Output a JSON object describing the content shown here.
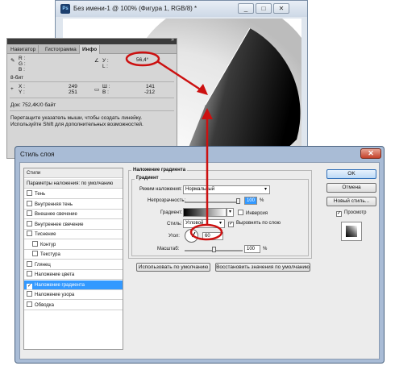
{
  "document": {
    "ps_label": "Ps",
    "title": "Без имени-1 @ 100% (Фигура 1, RGB/8) *",
    "minimize": "_",
    "maximize": "□",
    "close": "✕"
  },
  "info_panel": {
    "collapse": "»",
    "tabs": [
      "Навигатор",
      "Гистограмма",
      "Инфо"
    ],
    "r_label": "R :",
    "g_label": "G :",
    "b_label": "B :",
    "bit_depth": "8-бит",
    "y_label": "У :",
    "l_label": "L :",
    "angle_value": "56,4°",
    "x_label": "X :",
    "y2_label": "Y :",
    "x_value": "249",
    "y_value": "251",
    "w_label": "Ш :",
    "h_label": "В :",
    "w_value": "141",
    "h_value": "-212",
    "doc_size": "Док: 752,4K/0 байт",
    "hint_line1": "Перетащите указатель мыши, чтобы создать линейку.",
    "hint_line2": "Используйте Shift для дополнительных возможностей."
  },
  "dialog": {
    "title": "Стиль слоя",
    "close": "✕",
    "styles_header": "Стили",
    "blend_defaults": "Параметры наложения: по умолчанию",
    "style_items": [
      {
        "label": "Тень",
        "checked": false,
        "indent": false,
        "selected": false
      },
      {
        "label": "Внутренняя тень",
        "checked": false,
        "indent": false,
        "selected": false
      },
      {
        "label": "Внешнее свечение",
        "checked": false,
        "indent": false,
        "selected": false
      },
      {
        "label": "Внутреннее свечение",
        "checked": false,
        "indent": false,
        "selected": false
      },
      {
        "label": "Тиснение",
        "checked": false,
        "indent": false,
        "selected": false
      },
      {
        "label": "Контур",
        "checked": false,
        "indent": true,
        "selected": false
      },
      {
        "label": "Текстура",
        "checked": false,
        "indent": true,
        "selected": false
      },
      {
        "label": "Глянец",
        "checked": false,
        "indent": false,
        "selected": false
      },
      {
        "label": "Наложение цвета",
        "checked": false,
        "indent": false,
        "selected": false
      },
      {
        "label": "Наложение градиента",
        "checked": true,
        "indent": false,
        "selected": true
      },
      {
        "label": "Наложение узора",
        "checked": false,
        "indent": false,
        "selected": false
      },
      {
        "label": "Обводка",
        "checked": false,
        "indent": false,
        "selected": false
      }
    ],
    "section_title": "Наложение градиента",
    "group_title": "Градиент",
    "blend_mode_label": "Режим наложения:",
    "blend_mode_value": "Нормальный",
    "opacity_label": "Непрозрачность:",
    "opacity_value": "100",
    "percent": "%",
    "gradient_label": "Градиент:",
    "reverse_label": "Инверсия",
    "style_label": "Стиль:",
    "style_value": "Угловой",
    "align_label": "Выровнять по слою",
    "angle_label": "Угол:",
    "angle_value": "60",
    "scale_label": "Масштаб:",
    "scale_value": "100",
    "make_default": "Использовать по умолчанию",
    "reset_default": "Восстановить значения по умолчанию",
    "ok": "OK",
    "cancel": "Отмена",
    "new_style": "Новый стиль...",
    "preview_label": "Просмотр"
  }
}
